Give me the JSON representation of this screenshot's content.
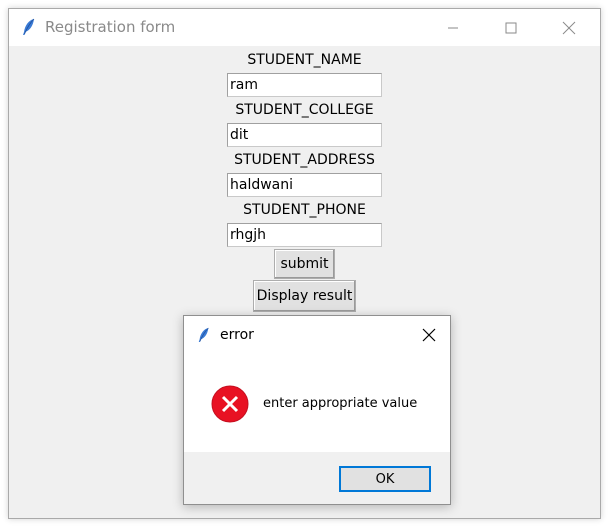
{
  "window": {
    "title": "Registration form"
  },
  "form": {
    "fields": [
      {
        "label": "STUDENT_NAME",
        "value": "ram"
      },
      {
        "label": "STUDENT_COLLEGE",
        "value": "dit"
      },
      {
        "label": "STUDENT_ADDRESS",
        "value": "haldwani"
      },
      {
        "label": "STUDENT_PHONE",
        "value": "rhgjh"
      }
    ],
    "submit_label": "submit",
    "display_label": "Display result"
  },
  "dialog": {
    "title": "error",
    "message": "enter appropriate value",
    "ok_label": "OK",
    "icon": "error-icon",
    "accent": "#0078d7",
    "error_color": "#e81123"
  }
}
